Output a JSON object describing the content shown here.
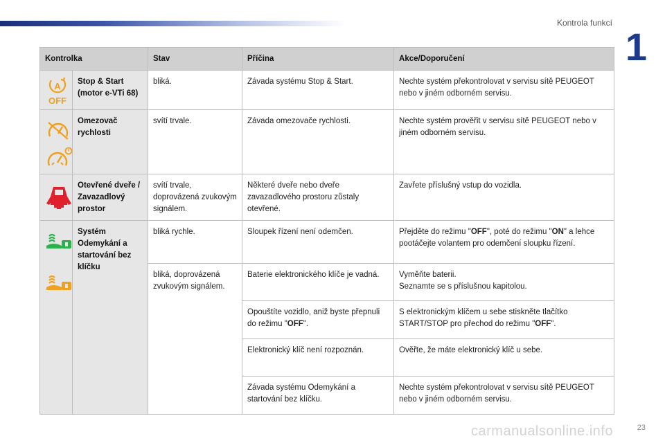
{
  "header": {
    "section_title": "Kontrola funkcí",
    "chapter": "1",
    "page_number": "23"
  },
  "watermark": "carmanualsonline.info",
  "colors": {
    "warning_amber": "#f0a020",
    "alert_red": "#e0202c",
    "ok_green": "#2bb24c"
  },
  "table": {
    "headers": [
      "Kontrolka",
      "Stav",
      "Příčina",
      "Akce/Doporučení"
    ],
    "stop_start": {
      "icon": "auto-stop-start-off-icon",
      "label": "Stop & Start (motor e-VTi 68)",
      "state": "bliká.",
      "cause": "Závada systému Stop & Start.",
      "action": "Nechte systém překontrolovat v servisu sítě PEUGEOT nebo v jiném odborném servisu."
    },
    "limiter": {
      "icons": [
        "speed-limiter-icon",
        "speed-limiter-fault-icon"
      ],
      "label": "Omezovač rychlosti",
      "state": "svítí trvale.",
      "cause": "Závada omezovače rychlosti.",
      "action": "Nechte systém prověřit v servisu sítě PEUGEOT nebo v jiném odborném servisu."
    },
    "doors": {
      "icon": "door-open-icon",
      "label": "Otevřené dveře / Zavazadlový prostor",
      "state": "svítí trvale, doprovázená zvukovým signálem.",
      "cause": "Některé dveře nebo dveře zavazadlového prostoru zůstaly otevřené.",
      "action": "Zavřete příslušný vstup do vozidla."
    },
    "keyless": {
      "icons": [
        "keyless-steering-unlock-icon",
        "keyless-key-battery-icon"
      ],
      "label": "Systém Odemykání a startování bez klíčku",
      "rows": [
        {
          "state": "bliká rychle.",
          "cause": "Sloupek řízení není odemčen.",
          "action_parts": [
            "Přejděte do režimu \"",
            "OFF",
            "\", poté do režimu \"",
            "ON",
            "\" a lehce pootáčejte volantem pro odemčení sloupku řízení."
          ]
        },
        {
          "state": "bliká, doprovázená zvukovým signálem.",
          "cause": "Baterie elektronického klíče je vadná.",
          "action_lines": [
            "Vyměňte baterii.",
            "Seznamte se s příslušnou kapitolou."
          ]
        },
        {
          "cause_parts": [
            "Opouštíte vozidlo, aniž byste přepnuli do režimu \"",
            "OFF",
            "\"."
          ],
          "action_parts": [
            "S elektronickým klíčem u sebe stiskněte tlačítko START/STOP pro přechod do režimu \"",
            "OFF",
            "\"."
          ]
        },
        {
          "cause": "Elektronický klíč není rozpoznán.",
          "action": "Ověřte, že máte elektronický klíč u sebe."
        },
        {
          "cause": "Závada systému Odemykání a startování bez klíčku.",
          "action": "Nechte systém překontrolovat v servisu sítě PEUGEOT nebo v jiném odborném servisu."
        }
      ]
    }
  }
}
